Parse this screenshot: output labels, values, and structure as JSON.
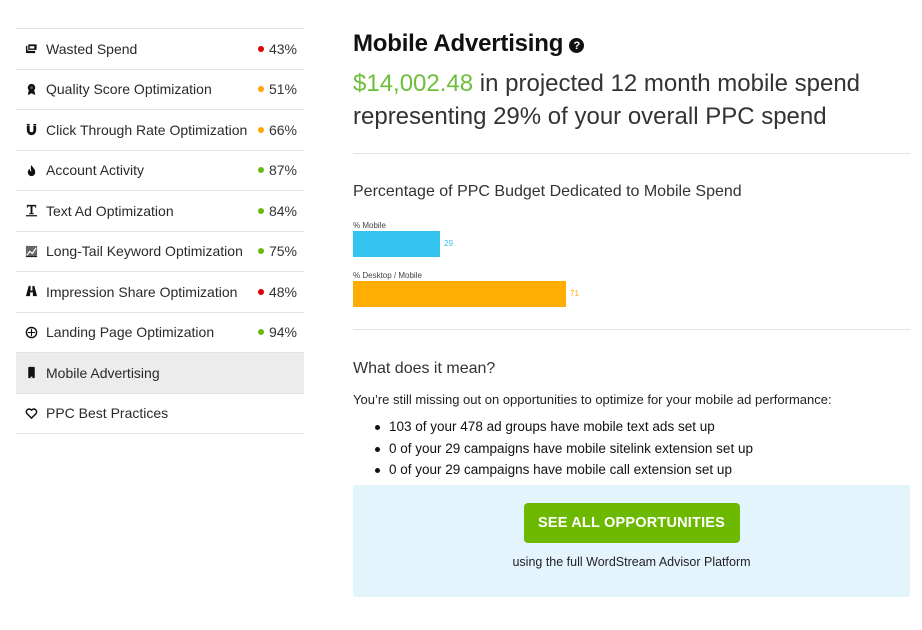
{
  "sidebar": {
    "items": [
      {
        "label": "Wasted Spend",
        "icon": "wallet-icon",
        "score": "43%",
        "status_color": "#e00000"
      },
      {
        "label": "Quality Score Optimization",
        "icon": "award-ribbon-icon",
        "score": "51%",
        "status_color": "#ffa500"
      },
      {
        "label": "Click Through Rate Optimization",
        "icon": "magnet-icon",
        "score": "66%",
        "status_color": "#ffa500"
      },
      {
        "label": "Account Activity",
        "icon": "flame-icon",
        "score": "87%",
        "status_color": "#66bb11"
      },
      {
        "label": "Text Ad Optimization",
        "icon": "text-icon",
        "score": "84%",
        "status_color": "#66bb11"
      },
      {
        "label": "Long-Tail Keyword Optimization",
        "icon": "chart-icon",
        "score": "75%",
        "status_color": "#66bb11"
      },
      {
        "label": "Impression Share Optimization",
        "icon": "binoculars-icon",
        "score": "48%",
        "status_color": "#e00000"
      },
      {
        "label": "Landing Page Optimization",
        "icon": "crosshair-icon",
        "score": "94%",
        "status_color": "#66bb11"
      },
      {
        "label": "Mobile Advertising",
        "icon": "mobile-phone-icon",
        "active": true
      },
      {
        "label": "PPC Best Practices",
        "icon": "heart-icon"
      }
    ]
  },
  "main": {
    "title": "Mobile Advertising",
    "help_icon": "question-circle-icon",
    "summary_amount": "$14,002.48",
    "summary_line1_rest": " in projected 12 month mobile spend",
    "summary_line2": "representing 29% of your overall PPC spend",
    "what_title": "What does it mean?",
    "what_paragraph": "You’re still missing out on opportunities to optimize for your mobile ad performance:",
    "bullets": [
      "103 of your 478 ad groups have mobile text ads set up",
      "0 of your 29 campaigns have mobile sitelink extension set up",
      "0 of your 29 campaigns have mobile call extension set up"
    ],
    "cta_button": "SEE ALL OPPORTUNITIES",
    "cta_subtext": "using the full WordStream Advisor Platform"
  },
  "chart_data": {
    "type": "bar",
    "orientation": "horizontal",
    "title": "Percentage of PPC Budget Dedicated to Mobile Spend",
    "categories": [
      "% Mobile",
      "% Desktop / Mobile"
    ],
    "values": [
      29,
      71
    ],
    "colors": [
      "#33c3ee",
      "#ffad00"
    ],
    "xlabel": "",
    "ylabel": "",
    "xlim": [
      0,
      100
    ],
    "grid": false,
    "data_labels": [
      "29",
      "71"
    ]
  }
}
